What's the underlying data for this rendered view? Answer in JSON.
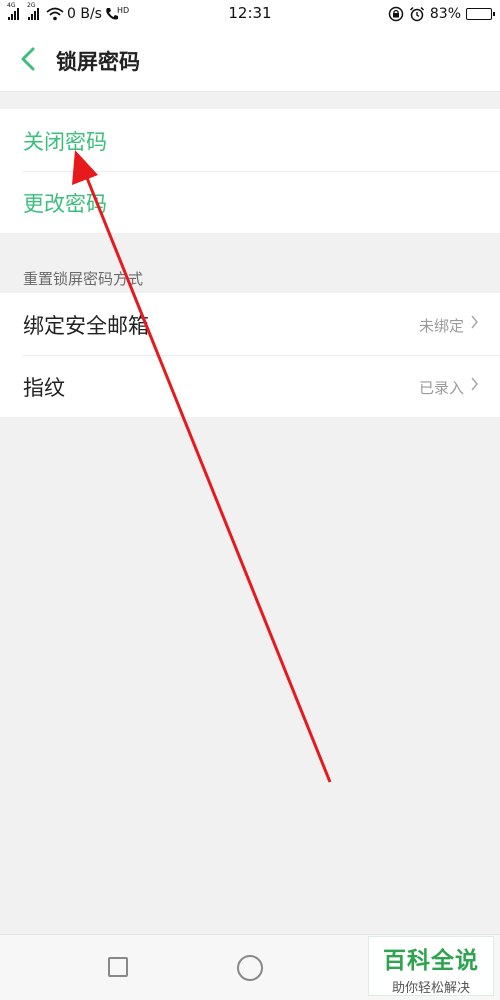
{
  "status_bar": {
    "net_tag_1": "4G",
    "net_tag_2": "2G",
    "speed": "0 B/s",
    "hd": "HD",
    "time": "12:31",
    "battery_percent": "83%",
    "battery_level": 0.83
  },
  "header": {
    "back_icon": "chevron-left-icon",
    "title": "锁屏密码"
  },
  "colors": {
    "accent": "#3bbf7c",
    "annotation_arrow": "#e8191c",
    "watermark": "#2ea44f"
  },
  "password_group": {
    "items": [
      {
        "label": "关闭密码"
      },
      {
        "label": "更改密码"
      }
    ]
  },
  "reset_section": {
    "header": "重置锁屏密码方式",
    "items": [
      {
        "label": "绑定安全邮箱",
        "value": "未绑定"
      },
      {
        "label": "指纹",
        "value": "已录入"
      }
    ]
  },
  "nav_bar": {
    "recent_icon": "square-icon",
    "home_icon": "circle-icon"
  },
  "watermark": {
    "title": "百科全说",
    "subtitle": "助你轻松解决"
  }
}
